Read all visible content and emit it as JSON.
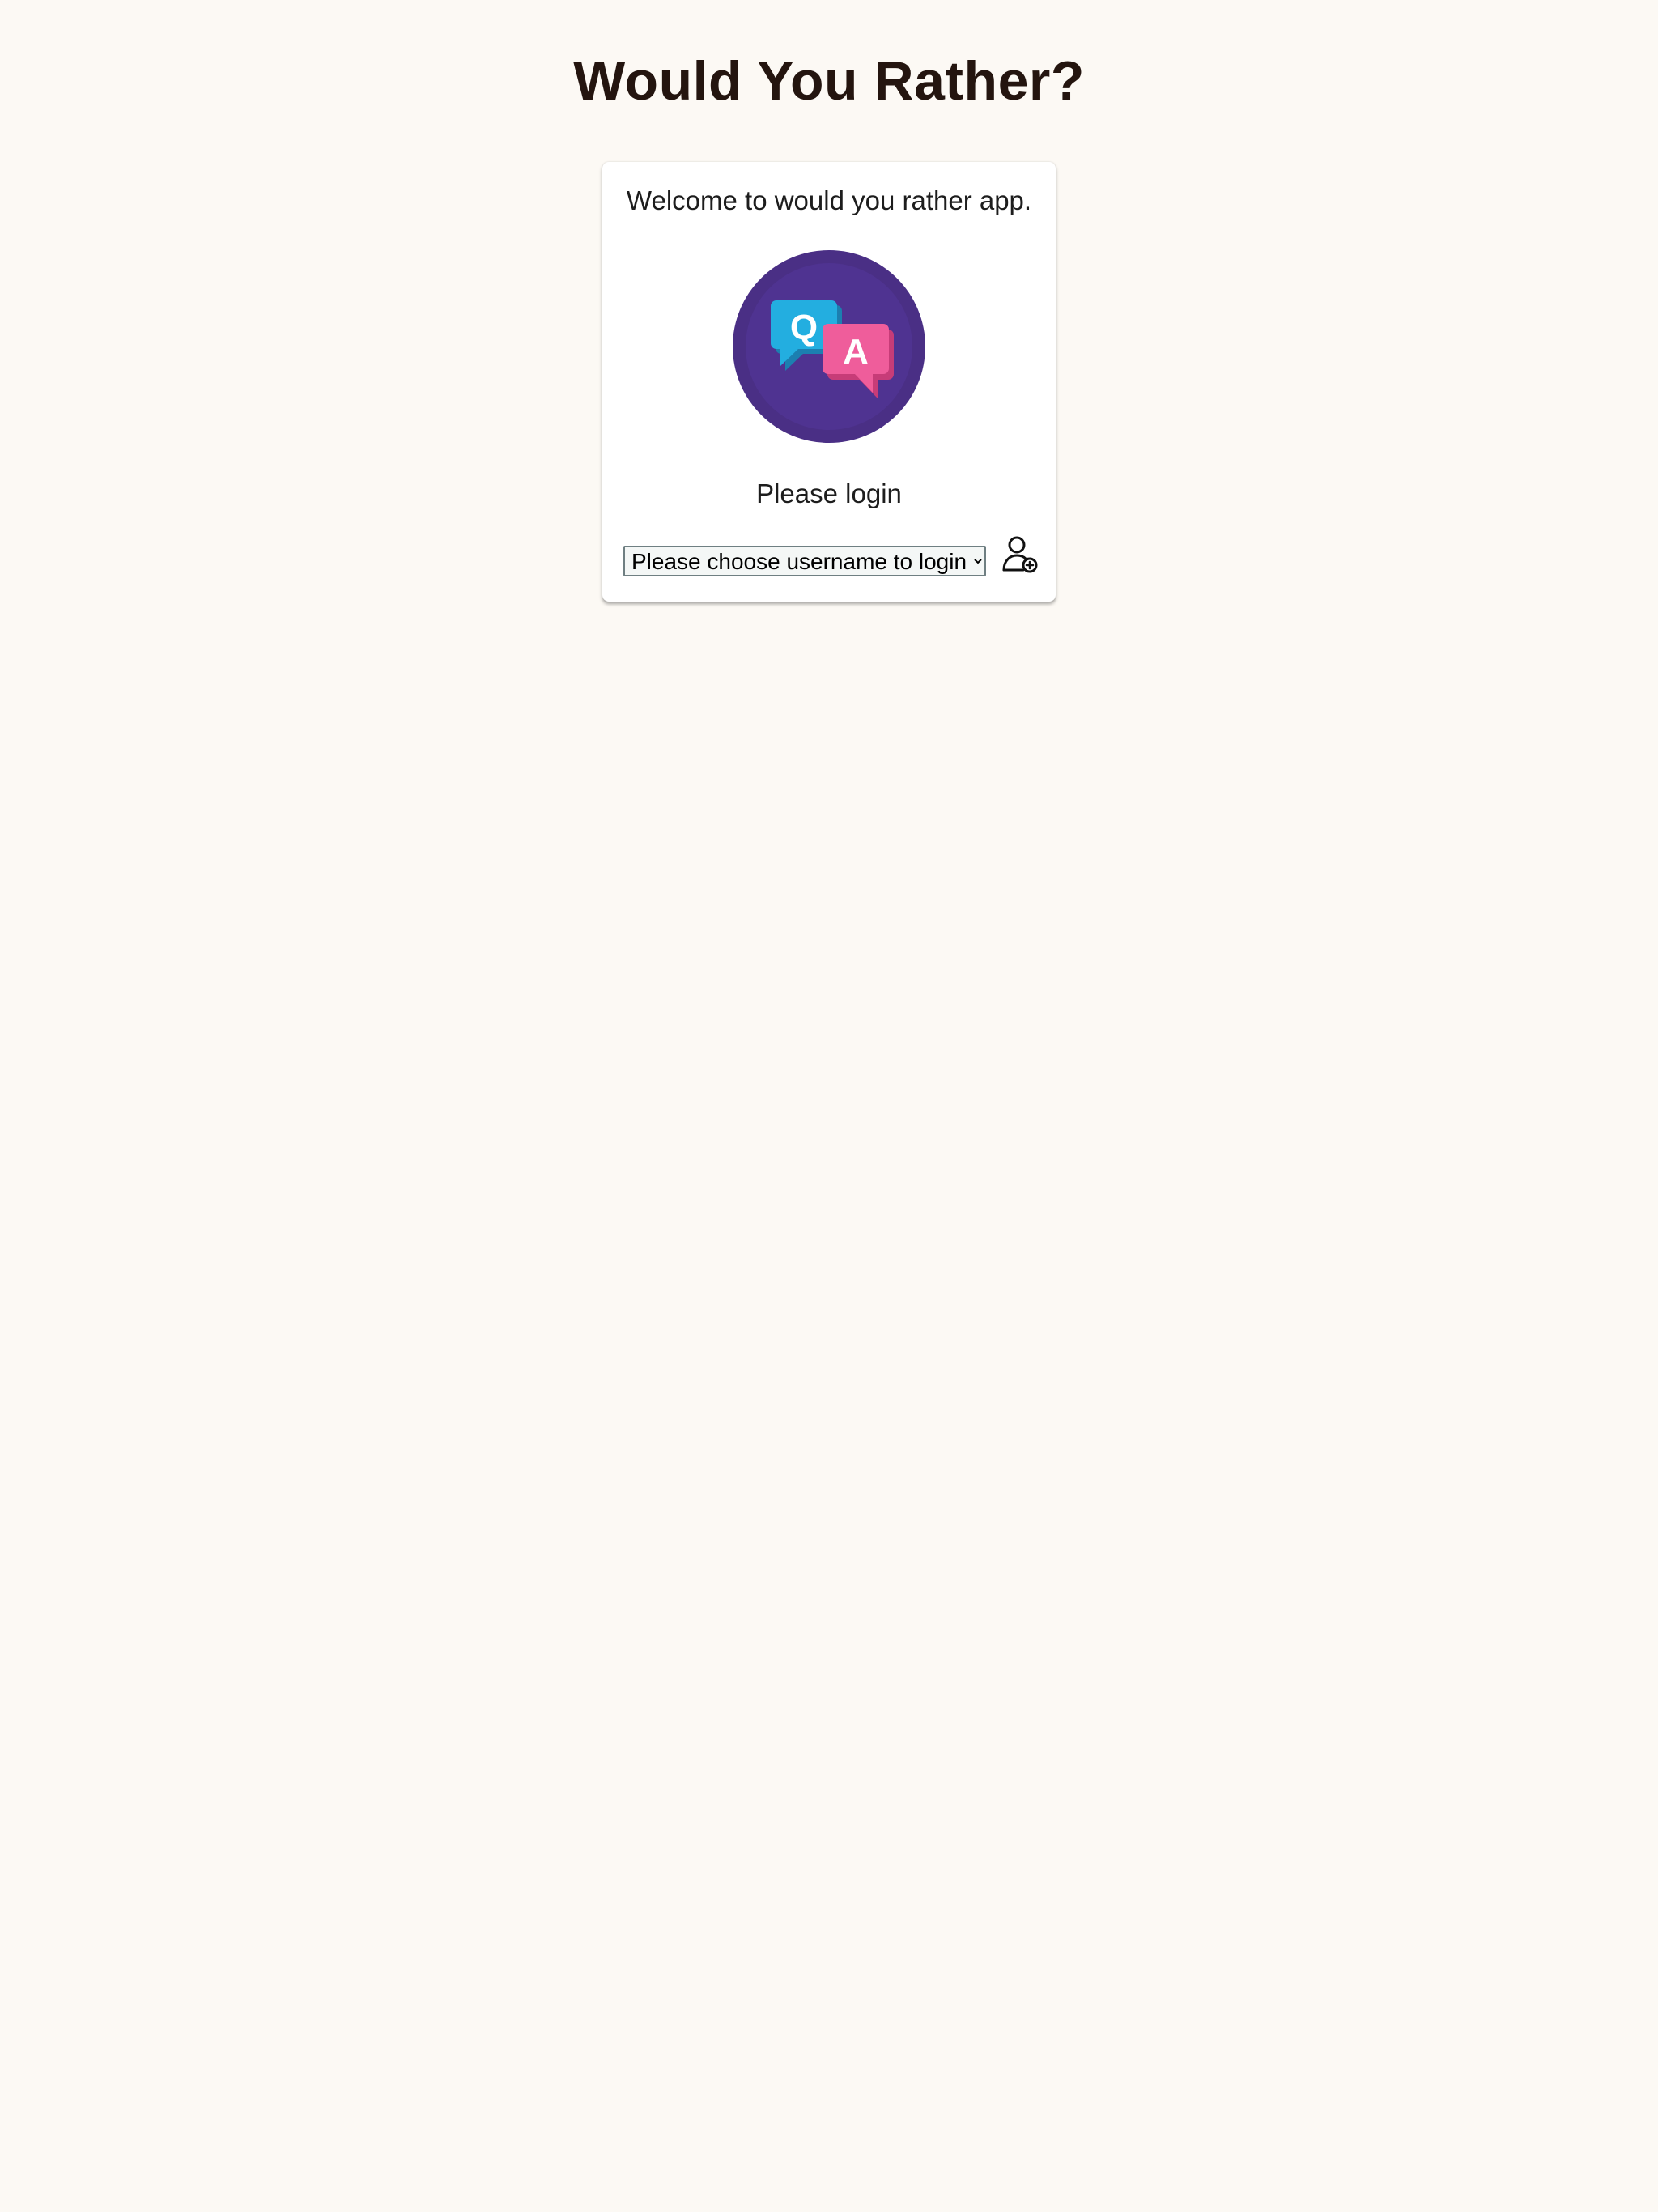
{
  "header": {
    "title": "Would You Rather?"
  },
  "login": {
    "welcome": "Welcome to would you rather app.",
    "logo_icon": "qa-chat-bubbles-icon",
    "logo_letters": {
      "q": "Q",
      "a": "A"
    },
    "prompt": "Please login",
    "select": {
      "selected": "Please choose username to login"
    },
    "submit_icon": "user-login-icon"
  },
  "colors": {
    "background": "#fcf9f4",
    "title": "#24150f",
    "logo_circle": "#4a2f85",
    "bubble_q": "#23aee0",
    "bubble_a": "#ef5d9b"
  }
}
